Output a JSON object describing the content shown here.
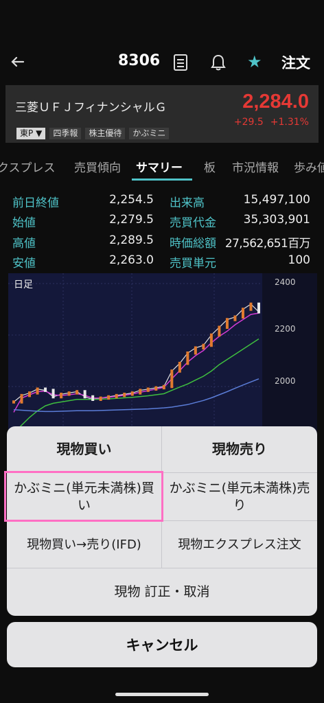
{
  "header": {
    "code": "8306",
    "order_label": "注文"
  },
  "stock": {
    "name": "三菱ＵＦＪフィナンシャルＧ",
    "price": "2,284.0",
    "change": "+29.5",
    "change_pct": "+1.31%",
    "market_label": "東P",
    "tags": [
      "四季報",
      "株主優待",
      "かぶミニ"
    ]
  },
  "tabs": [
    "クスプレス",
    "売買傾向",
    "サマリー",
    "板",
    "市況情報",
    "歩み値"
  ],
  "stats": {
    "left": [
      {
        "label": "前日終値",
        "value": "2,254.5"
      },
      {
        "label": "始値",
        "value": "2,279.5"
      },
      {
        "label": "高値",
        "value": "2,289.5"
      },
      {
        "label": "安値",
        "value": "2,263.0"
      }
    ],
    "right": [
      {
        "label": "出来高",
        "value": "15,497,100"
      },
      {
        "label": "売買代金",
        "value": "35,303,901"
      },
      {
        "label": "時価総額",
        "value": "27,562,651百万"
      },
      {
        "label": "売買単元",
        "value": "100"
      }
    ]
  },
  "chart_data": {
    "type": "line",
    "title": "日足",
    "y_ticks": [
      "2400",
      "2200",
      "2000"
    ],
    "ylim": [
      1800,
      2440
    ],
    "series": [
      {
        "name": "",
        "color": "#e0e0e0",
        "values": [
          1940,
          1965,
          1975,
          1990,
          1985,
          1960,
          1970,
          1975,
          1980,
          1960,
          1950,
          1955,
          1960,
          1965,
          1970,
          1975,
          1985,
          1990,
          1995,
          2000,
          2060,
          2090,
          2130,
          2150,
          2160,
          2200,
          2230,
          2260,
          2270,
          2300,
          2320,
          2290
        ]
      },
      {
        "name": "",
        "color": "#d43bd4",
        "values": [
          1900,
          1955,
          1968,
          1980,
          1982,
          1968,
          1965,
          1968,
          1972,
          1966,
          1955,
          1955,
          1958,
          1962,
          1966,
          1971,
          1978,
          1984,
          1990,
          1997,
          2030,
          2062,
          2095,
          2120,
          2140,
          2170,
          2195,
          2215,
          2240,
          2260,
          2280,
          2285
        ]
      },
      {
        "name": "",
        "color": "#3fbf3f",
        "values": [
          1820,
          1850,
          1880,
          1905,
          1925,
          1935,
          1940,
          1945,
          1950,
          1950,
          1950,
          1951,
          1952,
          1954,
          1956,
          1958,
          1961,
          1964,
          1968,
          1972,
          1985,
          1998,
          2010,
          2025,
          2040,
          2060,
          2085,
          2105,
          2125,
          2145,
          2165,
          2185
        ]
      },
      {
        "name": "",
        "color": "#5b7dd8",
        "values": [
          1910,
          1908,
          1906,
          1904,
          1903,
          1903,
          1904,
          1905,
          1906,
          1906,
          1906,
          1907,
          1908,
          1909,
          1910,
          1911,
          1912,
          1913,
          1915,
          1917,
          1920,
          1925,
          1930,
          1938,
          1946,
          1956,
          1968,
          1980,
          1993,
          2006,
          2018,
          2030
        ]
      }
    ]
  },
  "sheet": {
    "buy": "現物買い",
    "sell": "現物売り",
    "kabumini_buy": "かぶミニ(単元未満株)買い",
    "kabumini_sell": "かぶミニ(単元未満株)売り",
    "ifd": "現物買い→売り(IFD)",
    "express": "現物エクスプレス注文",
    "correct_cancel": "現物 訂正・取消"
  },
  "cancel_label": "キャンセル"
}
